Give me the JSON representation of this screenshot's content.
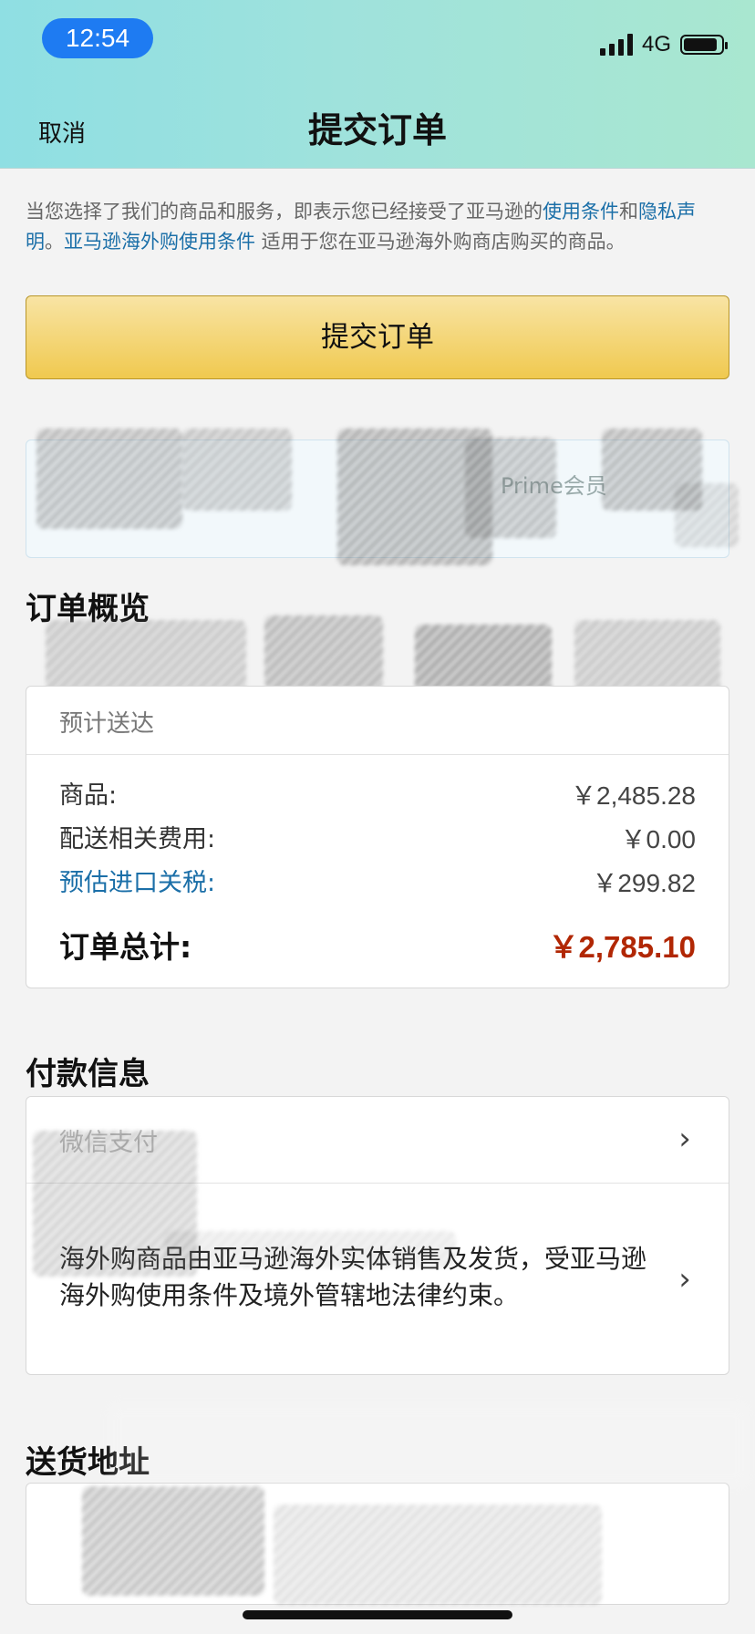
{
  "status_bar": {
    "time": "12:54",
    "network": "4G"
  },
  "nav": {
    "cancel": "取消",
    "title": "提交订单"
  },
  "notice": {
    "part1": "当您选择了我们的商品和服务，即表示您已经接受了亚马逊的",
    "link_terms": "使用条件",
    "and": "和",
    "link_privacy": "隐私声明",
    "period": "。",
    "link_global_terms": "亚马逊海外购使用条件",
    "part2": " 适用于您在亚马逊海外购商店购买的商品。"
  },
  "submit_button": "提交订单",
  "prime_banner": {
    "visible_text": "Prime会员"
  },
  "order_summary": {
    "title": "订单概览",
    "delivery_text": "预计送达",
    "items_label": "商品:",
    "items_value": "￥2,485.28",
    "shipping_label": "配送相关费用:",
    "shipping_value": "￥0.00",
    "duty_label": "预估进口关税:",
    "duty_value": "￥299.82",
    "total_label": "订单总计:",
    "total_value": "￥2,785.10"
  },
  "payment": {
    "title": "付款信息",
    "method": "微信支付",
    "note": "海外购商品由亚马逊海外实体销售及发货，受亚马逊海外购使用条件及境外管辖地法律约束。"
  },
  "shipping_address": {
    "title": "送货地址"
  },
  "colors": {
    "accent_link": "#1b6fa8",
    "total_price": "#b12704",
    "button_top": "#f8e4a4",
    "button_bottom": "#f0c94f",
    "time_pill": "#1e7bf2"
  }
}
